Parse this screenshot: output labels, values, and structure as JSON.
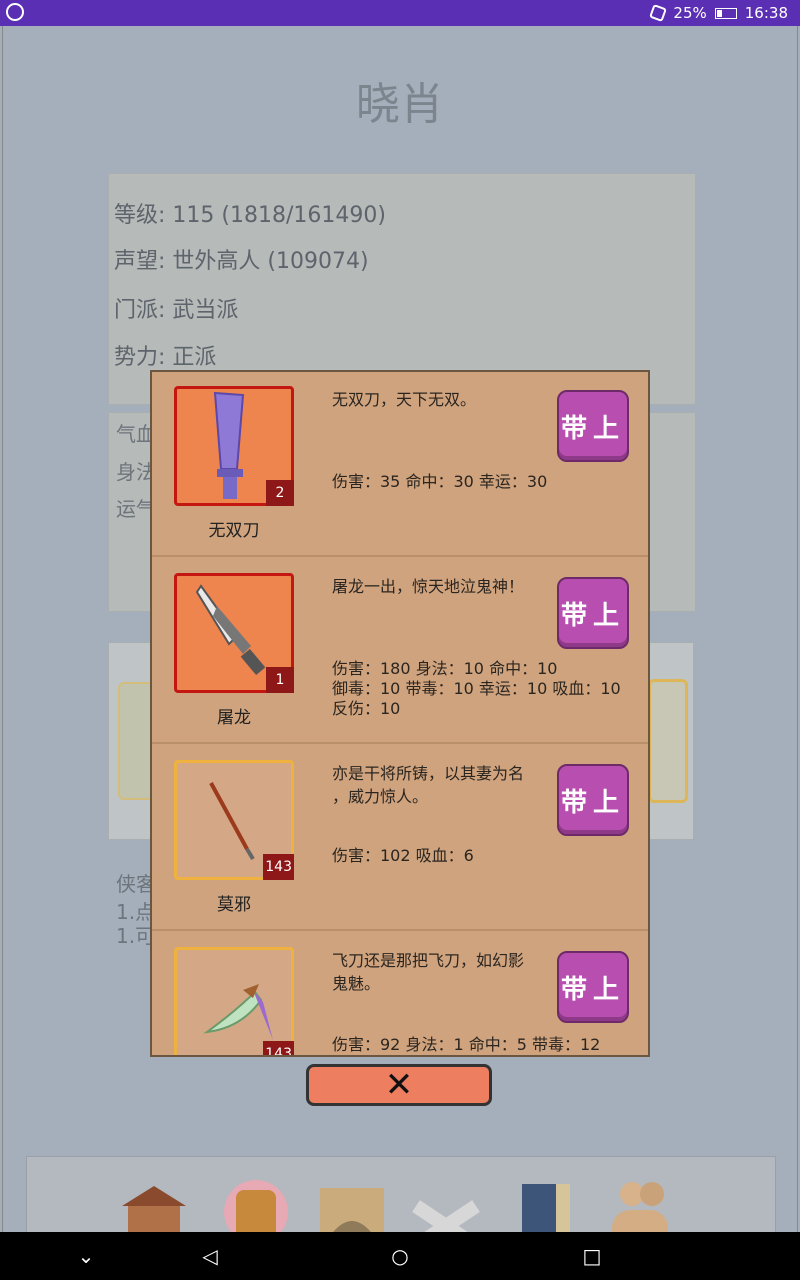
{
  "status": {
    "battery": "25%",
    "time": "16:38"
  },
  "page": {
    "title": "晓肖"
  },
  "info": {
    "level": "等级: 115 (1818/161490)",
    "fame": "声望: 世外高人 (109074)",
    "sect": "门派: 武当派",
    "faction": "势力:  正派"
  },
  "attrs": {
    "a1": "气血",
    "a2": "身法",
    "a3": "运气"
  },
  "hint": {
    "line1": "侠客",
    "line2": "1.点",
    "line3": "1.可"
  },
  "equip_label": "带上",
  "items": [
    {
      "name": "无双刀",
      "count": "2",
      "desc": "无双刀，天下无双。",
      "stats": "伤害：35 命中：30 幸运：30",
      "frame": "red",
      "icon": "purple-broadsword-icon"
    },
    {
      "name": "屠龙",
      "count": "1",
      "desc": "屠龙一出，惊天地泣鬼神！",
      "stats1": "伤害：180 身法：10 命中：10",
      "stats2": "御毒：10 带毒：10 幸运：10 吸血：10",
      "stats3": "反伤：10",
      "frame": "red",
      "icon": "dragon-saber-icon"
    },
    {
      "name": "莫邪",
      "count": "143",
      "desc1": "亦是干将所铸，以其妻为名",
      "desc2": "，威力惊人。",
      "stats": "伤害：102 吸血：6",
      "frame": "gold",
      "icon": "thin-sword-icon"
    },
    {
      "name": "",
      "count": "143",
      "desc1": "飞刀还是那把飞刀，如幻影",
      "desc2": "鬼魅。",
      "stats": "伤害：92 身法：1 命中：5 带毒：12",
      "frame": "gold",
      "icon": "flying-knife-icon"
    }
  ],
  "close_label": "✕"
}
